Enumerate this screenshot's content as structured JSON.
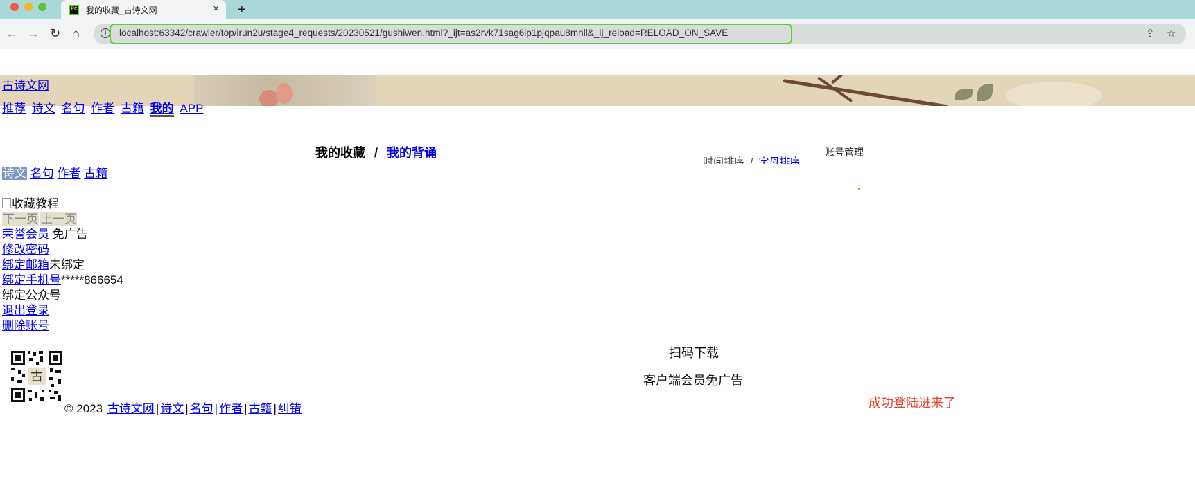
{
  "browser": {
    "tab_title": "我的收藏_古诗文网",
    "favicon_text": "PC",
    "url": "localhost:63342/crawler/top/irun2u/stage4_requests/20230521/gushiwen.html?_ijt=as2rvk71sag6ip1pjqpau8mnll&_ij_reload=RELOAD_ON_SAVE",
    "icons": {
      "close": "×",
      "new_tab": "+",
      "back": "←",
      "forward": "→",
      "reload": "↻",
      "home": "⌂",
      "info": "i",
      "share": "⇪",
      "bookmark": "☆"
    }
  },
  "site": {
    "logo": "古诗文网",
    "nav": [
      "推荐",
      "诗文",
      "名句",
      "作者",
      "古籍",
      "我的",
      "APP"
    ],
    "active_nav": "我的"
  },
  "main": {
    "section_title": "我的收藏",
    "separator": "/",
    "section_link": "我的背诵",
    "sort_time": "时间排序",
    "sort_sep": "/",
    "sort_alpha": "字母排序"
  },
  "sidebar": {
    "account_title": "账号管理"
  },
  "left": {
    "categories": [
      "诗文",
      "名句",
      "作者",
      "古籍"
    ],
    "selected_category": "诗文",
    "tutorial_alt": "收藏教程",
    "next_page": "下一页",
    "prev_page": "上一页",
    "vip_link": "荣誉会员",
    "vip_suffix": "免广告",
    "change_password": "修改密码",
    "bind_email": "绑定邮箱",
    "email_status": "未绑定",
    "bind_phone": "绑定手机号",
    "phone_value": "*****866654",
    "bind_wechat": "绑定公众号",
    "logout": "退出登录",
    "delete_account": "删除账号"
  },
  "footer": {
    "qr_char": "古",
    "copyright": "© 2023",
    "links": [
      "古诗文网",
      "诗文",
      "名句",
      "作者",
      "古籍",
      "纠错"
    ],
    "divider": "|",
    "scan_download": "扫码下载",
    "client_vip": "客户端会员免广告"
  },
  "status_message": "成功登陆进来了",
  "colors": {
    "link": "#0000ee",
    "success": "#e8412c",
    "url_focus": "#5bd12a",
    "tabstrip": "#a8d9d8",
    "selected_category": "#7b97c4"
  }
}
